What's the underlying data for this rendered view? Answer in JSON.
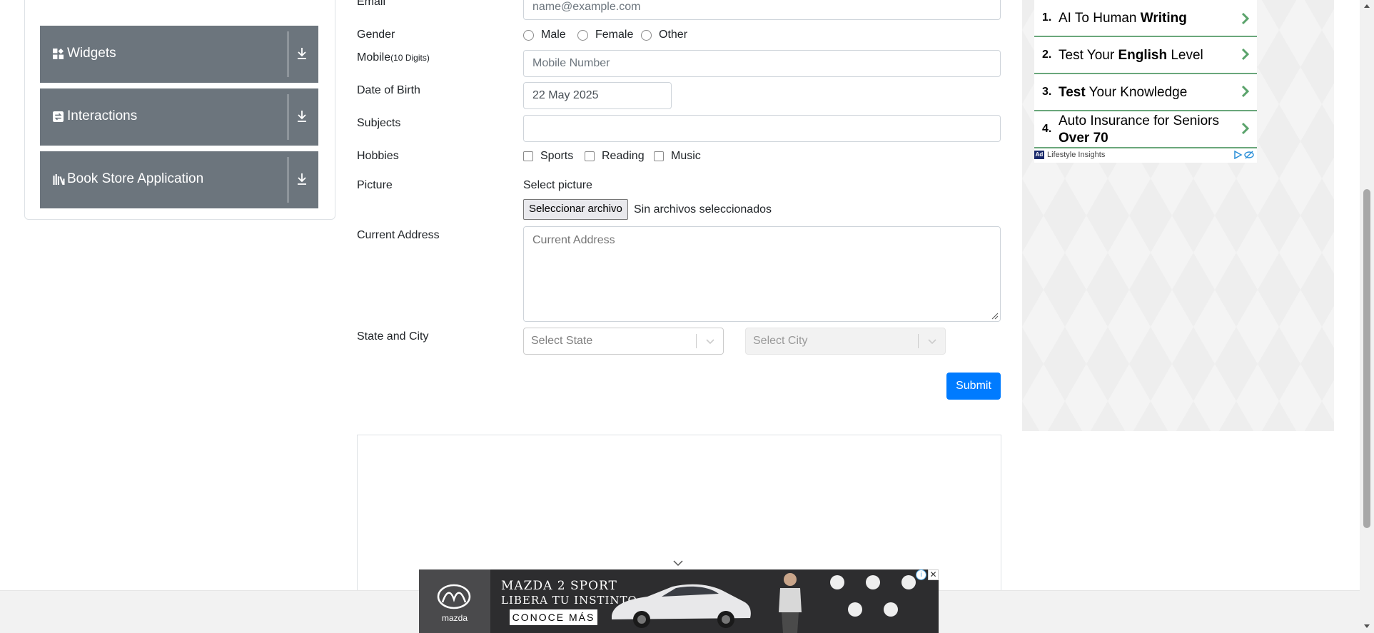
{
  "sidebar": {
    "groups": [
      {
        "label": "Widgets",
        "icon": "widgets-icon"
      },
      {
        "label": "Interactions",
        "icon": "interactions-icon"
      },
      {
        "label": "Book Store Application",
        "icon": "book-store-icon"
      }
    ]
  },
  "form": {
    "email": {
      "label": "Email",
      "placeholder": "name@example.com"
    },
    "gender": {
      "label": "Gender",
      "options": [
        "Male",
        "Female",
        "Other"
      ]
    },
    "mobile": {
      "label": "Mobile",
      "hint": "(10 Digits)",
      "placeholder": "Mobile Number"
    },
    "dob": {
      "label": "Date of Birth",
      "value": "22 May 2025"
    },
    "subjects": {
      "label": "Subjects",
      "value": ""
    },
    "hobbies": {
      "label": "Hobbies",
      "options": [
        "Sports",
        "Reading",
        "Music"
      ]
    },
    "picture": {
      "label": "Picture",
      "caption": "Select picture",
      "button": "Seleccionar archivo",
      "status": "Sin archivos seleccionados"
    },
    "address": {
      "label": "Current Address",
      "placeholder": "Current Address"
    },
    "state_city": {
      "label": "State and City",
      "state_placeholder": "Select State",
      "city_placeholder": "Select City"
    },
    "submit": "Submit"
  },
  "side_ad": {
    "items": [
      {
        "num": "1.",
        "pre": "AI To Human ",
        "bold": "Writing",
        "post": ""
      },
      {
        "num": "2.",
        "pre": "Test Your ",
        "bold": "English",
        "post": " Level"
      },
      {
        "num": "3.",
        "pre": "",
        "bold": "Test",
        "post": " Your Knowledge"
      },
      {
        "num": "4.",
        "pre": "Auto Insurance for Seniors ",
        "bold": "Over 70",
        "post": ""
      }
    ],
    "badge": "Ad",
    "source": "Lifestyle Insights"
  },
  "banner_ad": {
    "brand": "mazda",
    "headline": "MAZDA 2 SPORT",
    "subline": "LIBERA TU INSTINTO",
    "cta": "CONOCE MÁS"
  },
  "colors": {
    "sidebar_bg": "#6c757d",
    "submit_bg": "#007bff",
    "ad_divider": "#6aa77b"
  }
}
